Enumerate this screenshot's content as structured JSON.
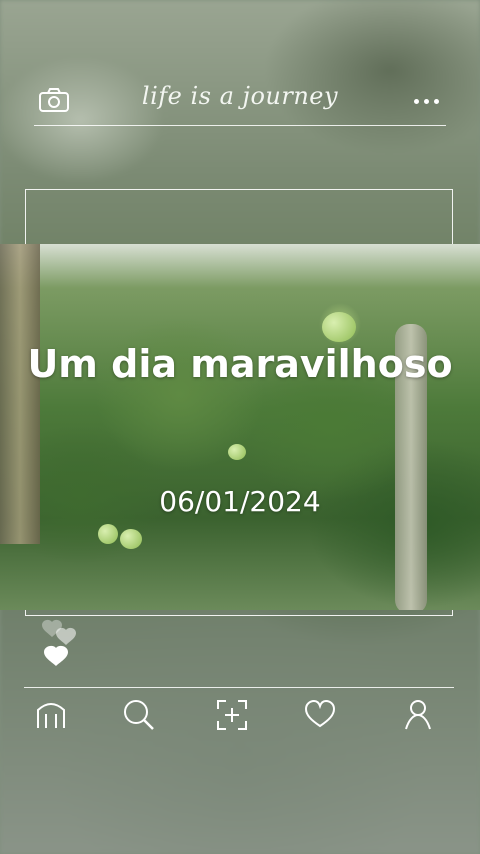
{
  "header": {
    "brand_title": "life is a journey",
    "left_icon": "camera-icon",
    "right_icon": "more-dots-icon"
  },
  "card": {
    "headline": "Um dia maravilhoso",
    "date": "06/01/2024"
  },
  "reactions": {
    "icons": [
      "heart-icon",
      "heart-icon",
      "heart-icon"
    ]
  },
  "bottom_nav": {
    "items": [
      {
        "name": "home",
        "icon": "home-icon"
      },
      {
        "name": "search",
        "icon": "search-icon"
      },
      {
        "name": "add",
        "icon": "add-square-icon"
      },
      {
        "name": "likes",
        "icon": "heart-outline-icon"
      },
      {
        "name": "profile",
        "icon": "profile-icon"
      }
    ]
  },
  "colors": {
    "text": "#ffffff",
    "lines": "#ffffff"
  }
}
